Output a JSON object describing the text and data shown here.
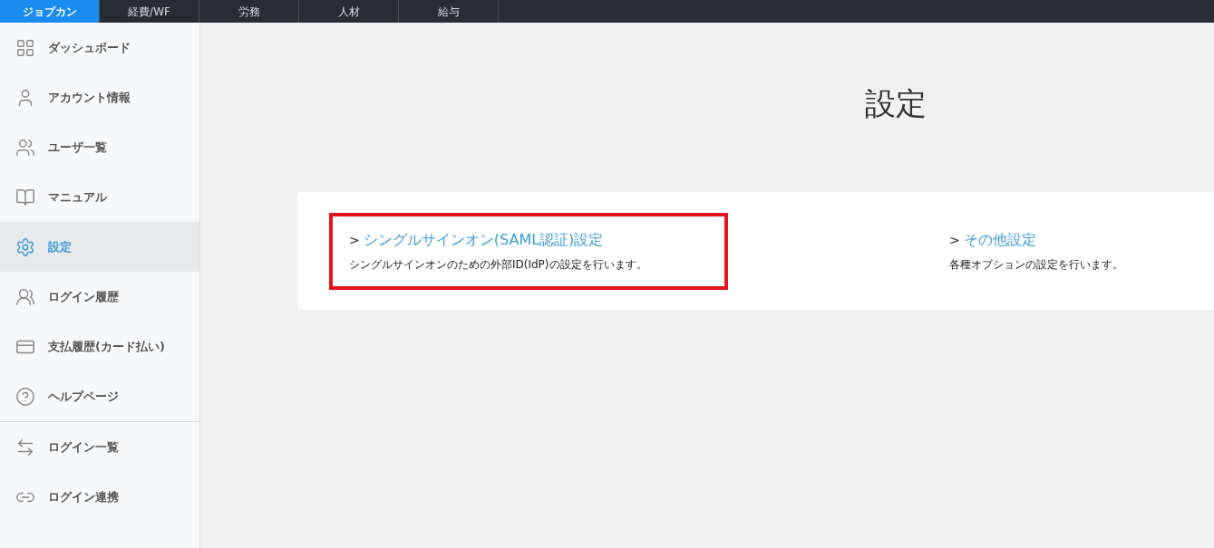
{
  "top_tabs": [
    {
      "label": "ジョブカン",
      "selected": true
    },
    {
      "label": "経費/WF",
      "selected": false
    },
    {
      "label": "労務",
      "selected": false
    },
    {
      "label": "人材",
      "selected": false
    },
    {
      "label": "給与",
      "selected": false
    }
  ],
  "sidebar": {
    "groups": [
      [
        {
          "kind": "grid",
          "label": "ダッシュボード",
          "selected": false
        },
        {
          "kind": "user",
          "label": "アカウント情報",
          "selected": false
        },
        {
          "kind": "users",
          "label": "ユーザ一覧",
          "selected": false
        },
        {
          "kind": "book",
          "label": "マニュアル",
          "selected": false
        },
        {
          "kind": "gear",
          "label": "設定",
          "selected": true
        },
        {
          "kind": "group",
          "label": "ログイン履歴",
          "selected": false
        },
        {
          "kind": "card",
          "label": "支払履歴(カード払い)",
          "selected": false
        },
        {
          "kind": "help",
          "label": "ヘルプページ",
          "selected": false
        }
      ],
      [
        {
          "kind": "arrows",
          "label": "ログイン一覧",
          "selected": false
        },
        {
          "kind": "link",
          "label": "ログイン連携",
          "selected": false
        }
      ]
    ]
  },
  "page": {
    "title": "設定",
    "sections": [
      {
        "arrow": ">",
        "link": "シングルサインオン(SAML認証)設定",
        "description": "シングルサインオンのための外部ID(IdP)の設定を行います。",
        "highlighted": true
      },
      {
        "arrow": ">",
        "link": "その他設定",
        "description": "各種オプションの設定を行います。",
        "highlighted": false
      }
    ]
  }
}
